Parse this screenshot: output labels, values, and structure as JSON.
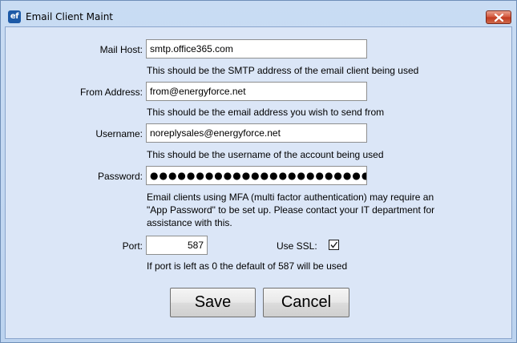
{
  "window": {
    "title": "Email Client Maint",
    "app_icon_text": "ef"
  },
  "form": {
    "mail_host": {
      "label": "Mail Host:",
      "value": "smtp.office365.com",
      "hint": "This should be the SMTP address of the email client being used"
    },
    "from_address": {
      "label": "From Address:",
      "value": "from@energyforce.net",
      "hint": "This should be the email address you wish to send from"
    },
    "username": {
      "label": "Username:",
      "value": "noreplysales@energyforce.net",
      "hint": "This should be the username of the account being used"
    },
    "password": {
      "label": "Password:",
      "masked_value": "●●●●●●●●●●●●●●●●●●●●●●●●●●●●●●●●●",
      "hint_lines": [
        "Email clients using MFA (multi factor authentication) may require an",
        "\"App Password\" to be set up. Please contact your IT department for",
        "assistance with this."
      ]
    },
    "port": {
      "label": "Port:",
      "value": "587",
      "hint": "If port is left as 0 the default of 587 will be used"
    },
    "use_ssl": {
      "label": "Use SSL:",
      "checked": true
    }
  },
  "buttons": {
    "save": "Save",
    "cancel": "Cancel"
  },
  "colors": {
    "frame": "#bcd3ef",
    "client_area": "#dbe6f7",
    "close_button": "#c9452c"
  }
}
